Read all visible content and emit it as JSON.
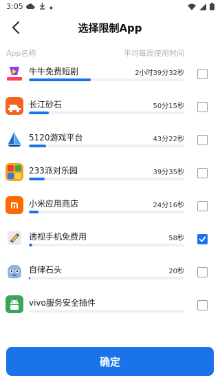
{
  "status_bar": {
    "time": "3:05",
    "icons_left": [
      "cloud-icon",
      "download-icon",
      "notification-dot-icon"
    ],
    "icons_right": [
      "wifi-icon",
      "signal-icon",
      "battery-icon"
    ]
  },
  "header": {
    "title": "选择限制App",
    "back_icon": "chevron-left-icon"
  },
  "list_header": {
    "left": "App名称",
    "right": "平均每周使用时间"
  },
  "colors": {
    "accent": "#1a73e8",
    "track": "#edf0f6"
  },
  "apps": [
    {
      "name": "牛牛免费短剧",
      "time": "2小时39分32秒",
      "usage_fraction": 0.4,
      "checked": false,
      "icon": "niuniu-app-icon",
      "icon_color": "#ff4d6d"
    },
    {
      "name": "长江砂石",
      "time": "50分15秒",
      "usage_fraction": 0.13,
      "checked": false,
      "icon": "changjiang-app-icon",
      "icon_color": "#f26522"
    },
    {
      "name": "5120游戏平台",
      "time": "43分22秒",
      "usage_fraction": 0.11,
      "checked": false,
      "icon": "sailboat-app-icon",
      "icon_color": "#1e6fd9"
    },
    {
      "name": "233派对乐园",
      "time": "39分35秒",
      "usage_fraction": 0.1,
      "checked": false,
      "icon": "party-app-icon",
      "icon_color": "#f4a31a"
    },
    {
      "name": "小米应用商店",
      "time": "24分16秒",
      "usage_fraction": 0.06,
      "checked": false,
      "icon": "mi-store-app-icon",
      "icon_color": "#ff6900"
    },
    {
      "name": "透视手机免费用",
      "time": "58秒",
      "usage_fraction": 0.02,
      "checked": true,
      "icon": "phone-app-icon",
      "icon_color": "#555555"
    },
    {
      "name": "自律石头",
      "time": "20秒",
      "usage_fraction": 0.01,
      "checked": false,
      "icon": "stone-app-icon",
      "icon_color": "#8fb3de"
    },
    {
      "name": "vivo服务安全插件",
      "time": "",
      "usage_fraction": 0.0,
      "checked": false,
      "icon": "android-app-icon",
      "icon_color": "#3aa55a"
    }
  ],
  "confirm_button": {
    "label": "确定"
  }
}
